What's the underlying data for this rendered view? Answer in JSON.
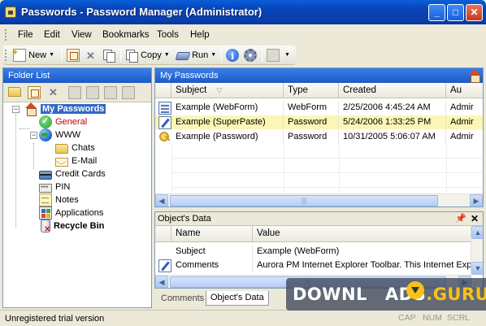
{
  "window": {
    "title": "Passwords - Password Manager (Administrator)",
    "controls": [
      "_",
      "□",
      "✕"
    ]
  },
  "menu": [
    "File",
    "Edit",
    "View",
    "Bookmarks",
    "Tools",
    "Help"
  ],
  "toolbar": {
    "new_label": "New",
    "copy_label": "Copy",
    "run_label": "Run"
  },
  "folder_list": {
    "title": "Folder List",
    "tree": [
      {
        "label": "My Passwords",
        "icon": "house-icon",
        "bold": true,
        "selected": true
      },
      {
        "label": "General",
        "icon": "check-icon",
        "color": "#c00000"
      },
      {
        "label": "WWW",
        "icon": "globe-icon"
      },
      {
        "label": "Chats",
        "icon": "folder-icon"
      },
      {
        "label": "E-Mail",
        "icon": "mail-icon"
      },
      {
        "label": "Credit Cards",
        "icon": "card-icon"
      },
      {
        "label": "PIN",
        "icon": "pin-icon"
      },
      {
        "label": "Notes",
        "icon": "note-icon"
      },
      {
        "label": "Applications",
        "icon": "apps-icon"
      },
      {
        "label": "Recycle Bin",
        "icon": "recycle-bin-icon",
        "bold": true
      }
    ]
  },
  "my_passwords": {
    "title": "My Passwords",
    "columns": [
      "Subject",
      "Type",
      "Created",
      "Au"
    ],
    "rows": [
      {
        "icon": "webform-icon",
        "subject": "Example (WebForm)",
        "type": "WebForm",
        "created": "2/25/2006 4:45:24 AM",
        "author": "Admir"
      },
      {
        "icon": "superpaste-icon",
        "subject": "Example (SuperPaste)",
        "type": "Password",
        "created": "5/24/2006 1:33:25 PM",
        "author": "Admir",
        "selected": true
      },
      {
        "icon": "key-icon",
        "subject": "Example (Password)",
        "type": "Password",
        "created": "10/31/2005 5:06:07 AM",
        "author": "Admir"
      }
    ]
  },
  "object_data": {
    "title": "Object's Data",
    "columns": [
      "Name",
      "Value"
    ],
    "rows": [
      {
        "icon": "",
        "name": "Subject",
        "value": "Example (WebForm)"
      },
      {
        "icon": "pen-icon",
        "name": "Comments",
        "value": "Aurora PM Internet Explorer Toolbar. This Internet Exp"
      }
    ]
  },
  "tabs": [
    "Comments",
    "Object's Data"
  ],
  "status": {
    "text": "Unregistered trial version",
    "indicators": [
      "CAP",
      "NUM",
      "SCRL"
    ]
  },
  "watermark": {
    "prefix": "DOWNL",
    "middle": "ADS",
    "suffix": ".GURU"
  }
}
